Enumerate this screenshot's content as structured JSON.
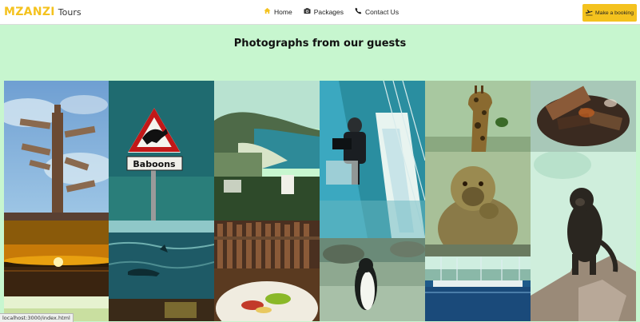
{
  "header": {
    "logo": {
      "primary": "MZANZI",
      "secondary": "Tours"
    },
    "nav": [
      {
        "label": "Home",
        "icon": "home-icon"
      },
      {
        "label": "Packages",
        "icon": "camera-icon"
      },
      {
        "label": "Contact Us",
        "icon": "phone-icon"
      }
    ],
    "cta": {
      "label": "Make a booking",
      "icon": "plane-icon"
    }
  },
  "main": {
    "title": "Photographs from our guests",
    "photos": [
      {
        "subject": "signpost",
        "icon": "signpost-photo"
      },
      {
        "subject": "baboon road sign",
        "sign_text": "Baboons",
        "icon": "baboons-sign-photo"
      },
      {
        "subject": "coastal bay",
        "icon": "bay-photo"
      },
      {
        "subject": "photographer on boat",
        "icon": "boat-photographer-photo"
      },
      {
        "subject": "giraffe",
        "icon": "giraffe-photo"
      },
      {
        "subject": "braai fire",
        "icon": "fire-photo"
      },
      {
        "subject": "sunset",
        "icon": "sunset-photo"
      },
      {
        "subject": "dolphins",
        "icon": "dolphins-photo"
      },
      {
        "subject": "wooden fence",
        "icon": "fence-photo"
      },
      {
        "subject": "penguin",
        "icon": "penguin-photo"
      },
      {
        "subject": "baby baboon",
        "icon": "baby-baboon-photo"
      },
      {
        "subject": "monkey on rock",
        "icon": "monkey-photo"
      },
      {
        "subject": "food plate",
        "icon": "food-photo"
      },
      {
        "subject": "harbour",
        "icon": "harbour-photo"
      }
    ]
  },
  "statusbar": {
    "text": "lo​calhost:3000/index.html"
  },
  "colors": {
    "accent": "#f4c21e",
    "page_bg": "#c7f6cf",
    "header_bg": "#ffffff"
  }
}
